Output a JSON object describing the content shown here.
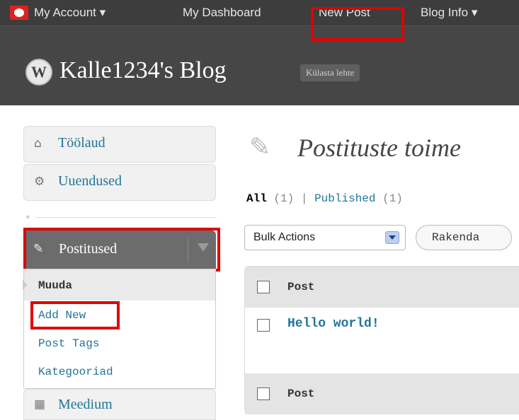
{
  "adminbar": {
    "my_account": "My Account ▾",
    "my_dashboard": "My Dashboard",
    "new_post": "New Post",
    "blog_info": "Blog Info ▾"
  },
  "header": {
    "blog_title": "Kalle1234's Blog",
    "visit_site": "Külasta lehte"
  },
  "sidebar": {
    "items": [
      {
        "label": "Töölaud",
        "icon": "home-icon"
      },
      {
        "label": "Uuendused",
        "icon": "gear-icon"
      },
      {
        "label": "Meedium",
        "icon": "media-icon"
      }
    ],
    "collapse": "«",
    "posts_menu": "Postitused",
    "submenu": {
      "current": "Muuda",
      "add_new": "Add New",
      "post_tags": "Post Tags",
      "categories": "Kategooriad"
    }
  },
  "main": {
    "page_title": "Postituste toime",
    "filters": {
      "all": "All",
      "all_count": "(1)",
      "sep": "|",
      "published": "Published",
      "published_count": "(1)"
    },
    "bulk_actions": "Bulk Actions",
    "apply": "Rakenda",
    "table": {
      "header": "Post",
      "footer": "Post",
      "rows": [
        {
          "title": "Hello world!"
        }
      ]
    }
  },
  "colors": {
    "accent_link": "#21759b",
    "highlight": "#e10000",
    "adminbar": "#464646"
  }
}
